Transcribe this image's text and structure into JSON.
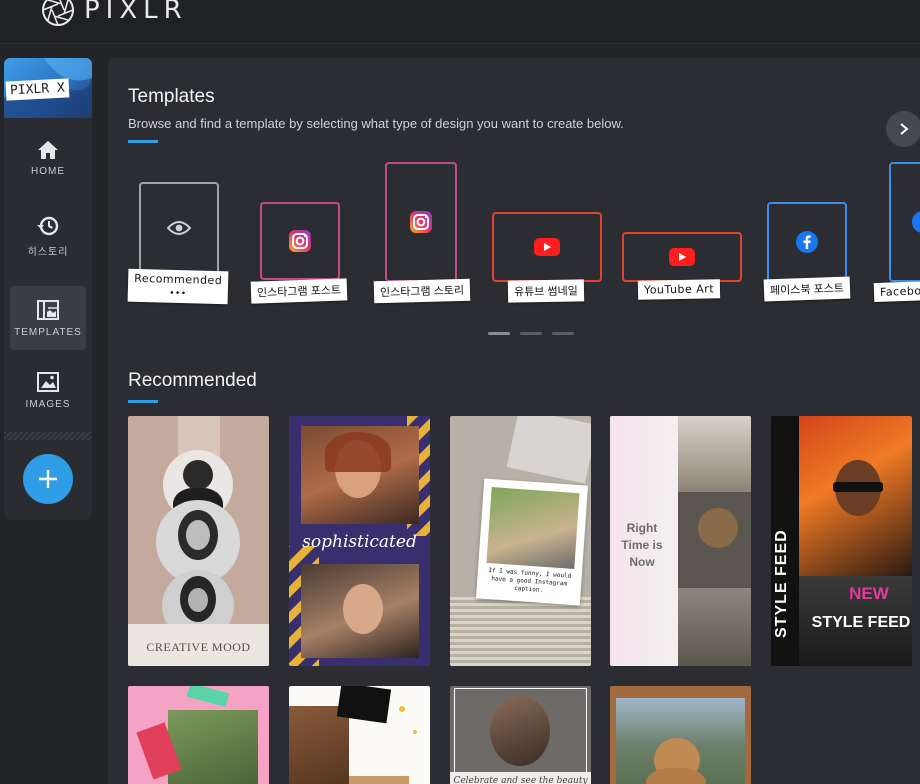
{
  "app": {
    "logo_text": "PIXLR"
  },
  "sidebar": {
    "brand": "PIXLR X",
    "items": [
      {
        "label": "HOME",
        "icon": "home-icon"
      },
      {
        "label": "히스토리",
        "icon": "history-icon"
      },
      {
        "label": "TEMPLATES",
        "icon": "templates-icon"
      },
      {
        "label": "IMAGES",
        "icon": "image-icon"
      }
    ],
    "add_icon": "plus-icon"
  },
  "templates": {
    "title": "Templates",
    "subtitle": "Browse and find a template by selecting what type of design you want to create below.",
    "types": [
      {
        "label": "Recommended",
        "extra": "•••",
        "icon": "eye-icon"
      },
      {
        "label": "인스타그램 포스트",
        "icon": "instagram-icon"
      },
      {
        "label": "인스타그램 스토리",
        "icon": "instagram-icon"
      },
      {
        "label": "유튜브 썸네일",
        "icon": "youtube-icon"
      },
      {
        "label": "YouTube Art",
        "icon": "youtube-icon"
      },
      {
        "label": "페이스북 포스트",
        "icon": "facebook-icon"
      },
      {
        "label": "Faceboo",
        "icon": "facebook-icon"
      }
    ]
  },
  "recommended": {
    "title": "Recommended",
    "cards": [
      {
        "caption": "CREATIVE MOOD"
      },
      {
        "caption": "sophisticated"
      },
      {
        "caption": "If I was funny, I would have a good Instagram caption."
      },
      {
        "caption": "Right Time is Now"
      },
      {
        "caption": "STYLE FEED",
        "caption_alt": "NEW"
      }
    ],
    "cards_row2": [
      {
        "caption": ""
      },
      {
        "caption": ""
      },
      {
        "caption": "Celebrate and see the beauty in"
      },
      {
        "caption": ""
      }
    ]
  },
  "colors": {
    "accent": "#2f9ee6",
    "instagram_border": "#c44b8a",
    "youtube_border": "#e0442e",
    "facebook_border": "#3c8fe6"
  }
}
